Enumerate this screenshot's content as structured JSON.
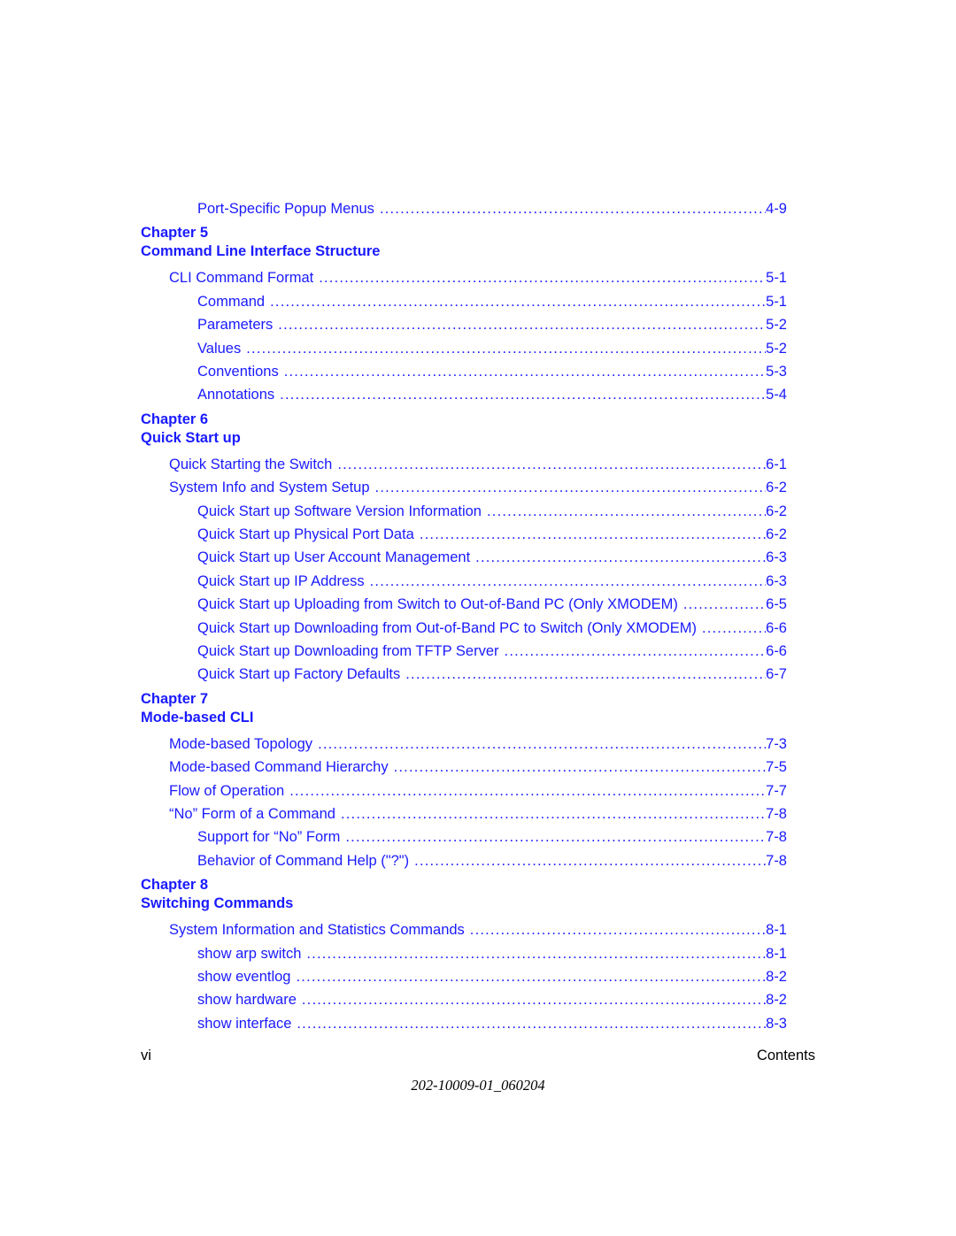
{
  "entries": [
    {
      "level": 2,
      "title": "Port-Specific Popup Menus",
      "page": "4-9"
    },
    {
      "chapter": "Chapter 5",
      "heading": "Command Line Interface Structure"
    },
    {
      "level": 1,
      "title": "CLI Command Format",
      "page": "5-1"
    },
    {
      "level": 2,
      "title": "Command",
      "page": "5-1"
    },
    {
      "level": 2,
      "title": "Parameters",
      "page": "5-2"
    },
    {
      "level": 2,
      "title": "Values",
      "page": "5-2"
    },
    {
      "level": 2,
      "title": "Conventions",
      "page": "5-3"
    },
    {
      "level": 2,
      "title": "Annotations",
      "page": "5-4"
    },
    {
      "chapter": "Chapter 6",
      "heading": "Quick Start up"
    },
    {
      "level": 1,
      "title": "Quick Starting the Switch",
      "page": "6-1"
    },
    {
      "level": 1,
      "title": "System Info and System Setup",
      "page": "6-2"
    },
    {
      "level": 2,
      "title": "Quick Start up Software Version Information",
      "page": "6-2"
    },
    {
      "level": 2,
      "title": "Quick Start up Physical Port Data",
      "page": "6-2"
    },
    {
      "level": 2,
      "title": "Quick Start up User Account Management",
      "page": "6-3"
    },
    {
      "level": 2,
      "title": "Quick Start up IP Address",
      "page": "6-3"
    },
    {
      "level": 2,
      "title": "Quick Start up Uploading from Switch to Out-of-Band PC (Only XMODEM)",
      "page": "6-5"
    },
    {
      "level": 2,
      "title": "Quick Start up Downloading from Out-of-Band PC to Switch (Only XMODEM)",
      "page": "6-6"
    },
    {
      "level": 2,
      "title": "Quick Start up Downloading from TFTP Server",
      "page": "6-6"
    },
    {
      "level": 2,
      "title": "Quick Start up Factory Defaults",
      "page": "6-7"
    },
    {
      "chapter": "Chapter 7",
      "heading": "Mode-based CLI"
    },
    {
      "level": 1,
      "title": "Mode-based Topology",
      "page": "7-3"
    },
    {
      "level": 1,
      "title": "Mode-based Command Hierarchy",
      "page": "7-5"
    },
    {
      "level": 1,
      "title": "Flow of Operation",
      "page": "7-7"
    },
    {
      "level": 1,
      "title": "“No” Form of a Command",
      "page": "7-8"
    },
    {
      "level": 2,
      "title": "Support for “No” Form",
      "page": "7-8"
    },
    {
      "level": 2,
      "title": "Behavior of Command Help (\"?\")",
      "page": "7-8"
    },
    {
      "chapter": "Chapter 8",
      "heading": "Switching Commands"
    },
    {
      "level": 1,
      "title": "System Information and Statistics Commands",
      "page": "8-1"
    },
    {
      "level": 2,
      "title": "show arp switch",
      "page": "8-1"
    },
    {
      "level": 2,
      "title": "show eventlog",
      "page": "8-2"
    },
    {
      "level": 2,
      "title": "show hardware",
      "page": "8-2"
    },
    {
      "level": 2,
      "title": "show interface",
      "page": "8-3"
    }
  ],
  "footer": {
    "page_number": "vi",
    "section": "Contents",
    "doc_id": "202-10009-01_060204"
  }
}
